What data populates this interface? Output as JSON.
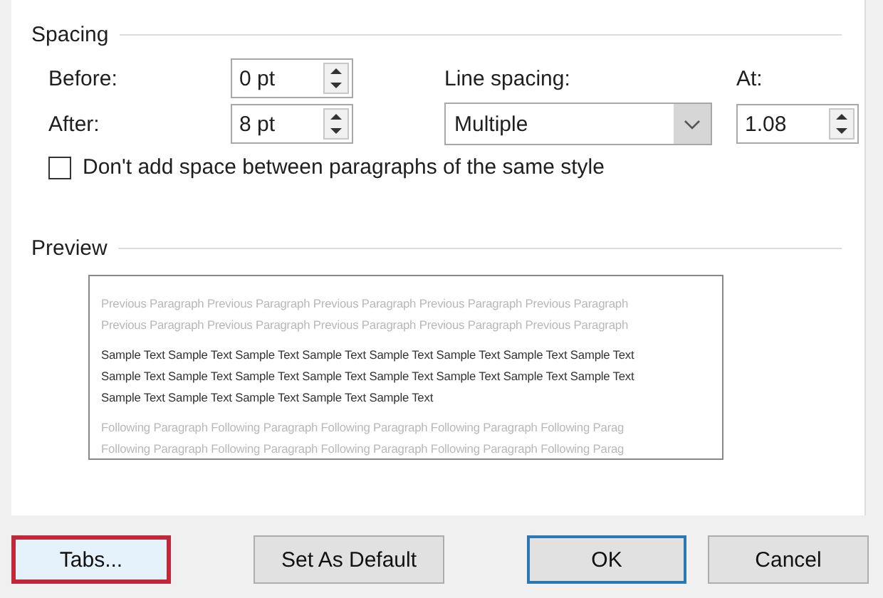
{
  "spacing": {
    "title": "Spacing",
    "before": {
      "label": "Before:",
      "value": "0 pt"
    },
    "after": {
      "label": "After:",
      "value": "8 pt"
    },
    "line_spacing": {
      "label": "Line spacing:",
      "value": "Multiple"
    },
    "at": {
      "label": "At:",
      "value": "1.08"
    },
    "dont_add_space": {
      "label": "Don't add space between paragraphs of the same style",
      "checked": false
    }
  },
  "preview": {
    "title": "Preview",
    "lines": [
      {
        "kind": "previous",
        "text": "Previous Paragraph Previous Paragraph Previous Paragraph Previous Paragraph Previous Paragraph"
      },
      {
        "kind": "previous",
        "text": "Previous Paragraph Previous Paragraph Previous Paragraph Previous Paragraph Previous Paragraph"
      },
      {
        "kind": "sample",
        "text": "Sample Text Sample Text Sample Text Sample Text Sample Text Sample Text Sample Text Sample Text"
      },
      {
        "kind": "sample",
        "text": "Sample Text Sample Text Sample Text Sample Text Sample Text Sample Text Sample Text Sample Text"
      },
      {
        "kind": "sample",
        "text": "Sample Text Sample Text Sample Text Sample Text Sample Text"
      },
      {
        "kind": "following",
        "text": "Following Paragraph Following Paragraph Following Paragraph Following Paragraph Following Parag"
      },
      {
        "kind": "following",
        "text": "Following Paragraph Following Paragraph Following Paragraph Following Paragraph Following Parag"
      }
    ]
  },
  "buttons": [
    {
      "label": "Tabs...",
      "highlighted": true,
      "default": false
    },
    {
      "label": "Set As Default",
      "highlighted": false,
      "default": false
    },
    {
      "label": "OK",
      "highlighted": false,
      "default": true
    },
    {
      "label": "Cancel",
      "highlighted": false,
      "default": false
    }
  ]
}
